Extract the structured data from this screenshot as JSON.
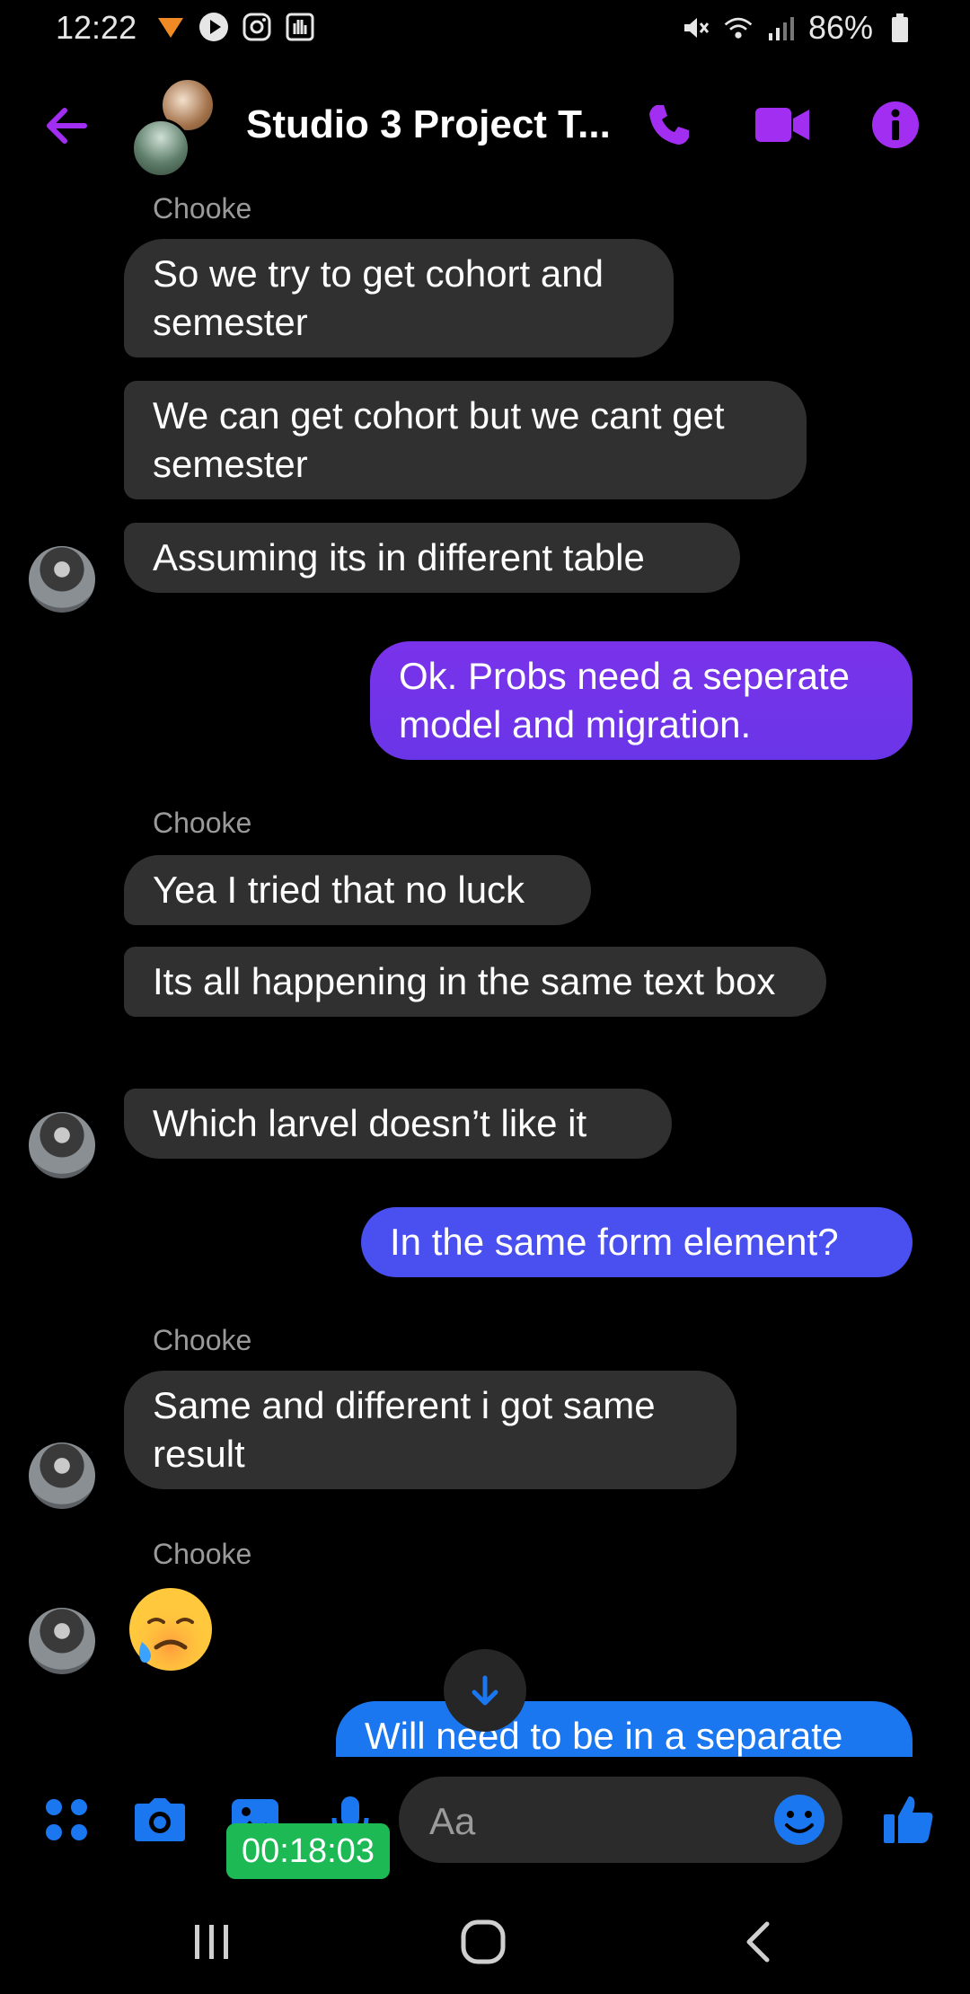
{
  "status_bar": {
    "time": "12:22",
    "battery": "86%"
  },
  "header": {
    "title": "Studio 3 Project T..."
  },
  "messages": [
    {
      "sender": "Chooke",
      "texts": [
        "So we try to get cohort and semester",
        "We can get cohort but we cant get semester",
        "Assuming its in different table"
      ]
    },
    {
      "out": "Ok. Probs need a seperate model and migration."
    },
    {
      "sender": "Chooke",
      "texts": [
        "Yea I tried that no luck",
        "Its all  happening in the same text box",
        "Which larvel  doesn’t like it"
      ]
    },
    {
      "out": "In the same form element?"
    },
    {
      "sender": "Chooke",
      "texts": [
        "Same and different i got same result"
      ]
    },
    {
      "sender": "Chooke",
      "emoji": "crying-smile"
    },
    {
      "out_partial": "Will need to be in a separate"
    }
  ],
  "composer": {
    "placeholder": "Aa",
    "recording_timer": "00:18:03"
  },
  "colors": {
    "accent": "#a12ef0",
    "out_bubble_top": "#6a35e8",
    "out_bubble_mid": "#4a4ff0",
    "out_bubble_bottom": "#1b77f0",
    "in_bubble": "#303030"
  }
}
